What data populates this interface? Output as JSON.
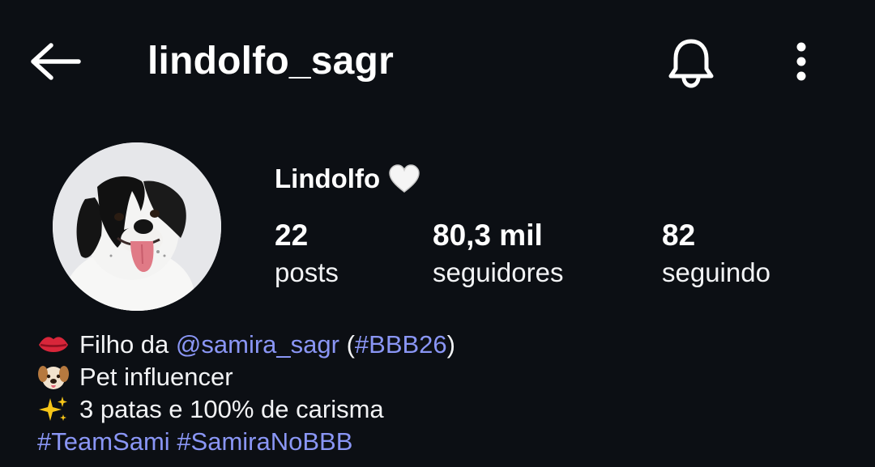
{
  "header": {
    "username": "lindolfo_sagr",
    "back_icon": "arrow-left-icon",
    "notification_icon": "bell-icon",
    "more_icon": "more-vertical-icon"
  },
  "profile": {
    "display_name": "Lindolfo",
    "name_emoji": "white-heart-icon",
    "avatar_description_icon": "dog-avatar",
    "stats": [
      {
        "value": "22",
        "label": "posts"
      },
      {
        "value": "80,3 mil",
        "label": "seguidores"
      },
      {
        "value": "82",
        "label": "seguindo"
      }
    ]
  },
  "bio": {
    "line1": {
      "emoji": "lips-icon",
      "prefix": "Filho da",
      "mention": "@samira_sagr",
      "open_paren": "(",
      "hashtag": "#BBB26",
      "close_paren": ")"
    },
    "line2": {
      "emoji": "dog-face-icon",
      "text": "Pet influencer"
    },
    "line3": {
      "emoji": "sparkles-icon",
      "text": "3 patas e 100% de carisma"
    },
    "line4": {
      "hashtag1": "#TeamSami",
      "hashtag2": "#SamiraNoBBB"
    }
  },
  "colors": {
    "background": "#0c0f14",
    "text": "#f2f3f5",
    "link": "#8a96f5"
  }
}
